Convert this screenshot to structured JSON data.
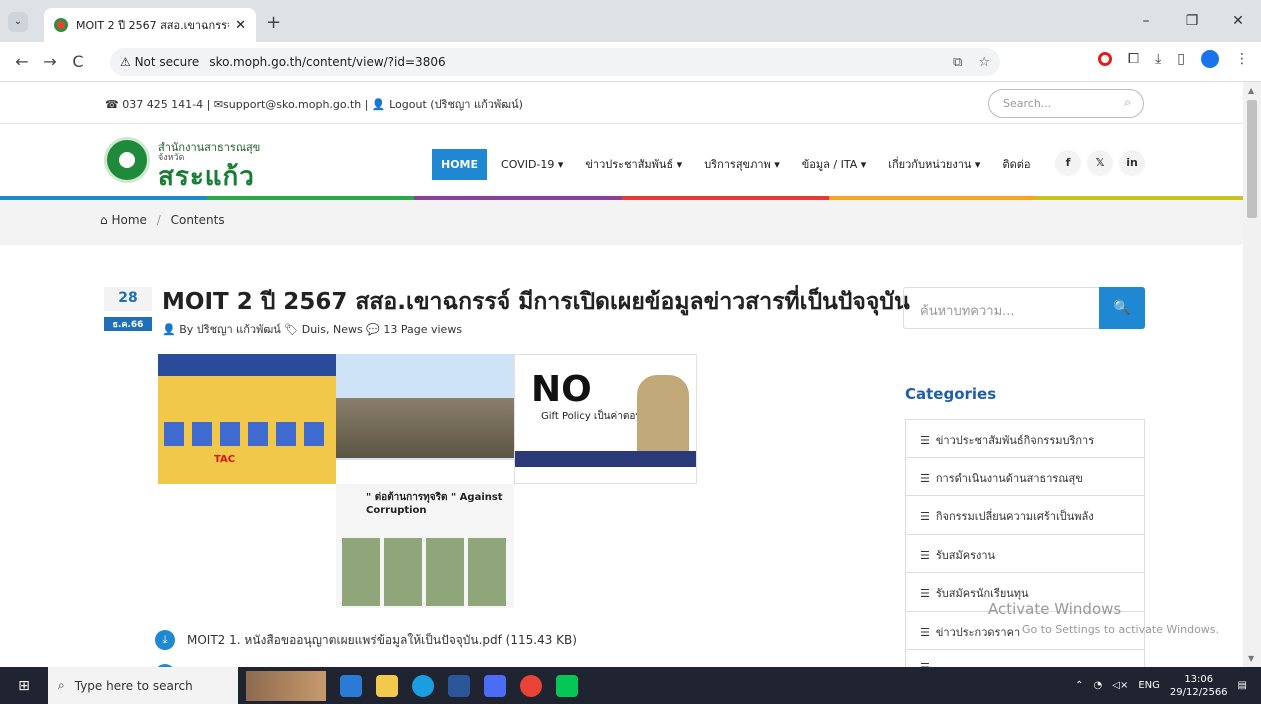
{
  "browser": {
    "tab_title": "MOIT 2 ปี 2567 สสอ.เขาฉกรรจ์ มีก",
    "tab_close": "✕",
    "new_tab": "+",
    "tab_list": "⌄",
    "back": "←",
    "forward": "→",
    "reload": "C",
    "security": "⚠ Not secure",
    "url": "sko.moph.go.th/content/view/?id=3806",
    "win_min": "–",
    "win_max": "❐",
    "win_close": "✕"
  },
  "topbar": {
    "contact": "☎ 037 425 141-4 | ✉support@sko.moph.go.th | 👤 Logout (ปริชญา แก้วพัฒน์)",
    "search_placeholder": "Search..."
  },
  "logo": {
    "line1": "สำนักงานสาธารณสุข",
    "line2": "จังหวัด",
    "line3": "สระแก้ว"
  },
  "menu": {
    "items": [
      "HOME",
      "COVID-19 ▾",
      "ข่าวประชาสัมพันธ์ ▾",
      "บริการสุขภาพ ▾",
      "ข้อมูล / ITA ▾",
      "เกี่ยวกับหน่วยงาน ▾",
      "ติดต่อ"
    ],
    "social": [
      "f",
      "𝕏",
      "in"
    ]
  },
  "colors": {
    "accent": "#1e88d2",
    "bar": [
      "#1e88d2",
      "#2ba84a",
      "#8a3f99",
      "#e53935",
      "#f5a623",
      "#c7c41c"
    ]
  },
  "breadcrumb": {
    "home": "Home",
    "current": "Contents",
    "separator": "/"
  },
  "article": {
    "day": "28",
    "month": "ธ.ค.66",
    "title": "MOIT 2 ปี 2567 สสอ.เขาฉกรรจ์ มีการเปิดเผยข้อมูลข่าวสารที่เป็นปัจจุบัน",
    "meta": "👤 By ปริชญา แก้วพัฒน์  🏷 Duis, News  💬 13 Page views",
    "img3_big": "NO",
    "img3_gift": "Gift Policy เป็นค่าตอบแทน",
    "img1_tac": "TAC",
    "img4_caption": "\" ต่อต้านการทุจริต \"\nAgainst Corruption",
    "attachment": "MOIT2 1. หนังสือขออนุญาตเผยแพร่ข้อมูลให้เป็นปัจจุบัน.pdf (115.43 KB)"
  },
  "sidebar": {
    "search_placeholder": "ค้นหาบทความ...",
    "search_button": "🔍",
    "categories_title": "Categories",
    "categories": [
      "ข่าวประชาสัมพันธ์กิจกรรมบริการ",
      "การดำเนินงานด้านสาธารณสุข",
      "กิจกรรมเปลี่ยนความเศร้าเป็นพลัง",
      "รับสมัครงาน",
      "รับสมัครนักเรียนทุน",
      "ข่าวประกวดราคา",
      ""
    ]
  },
  "watermark": {
    "line1": "Activate Windows",
    "line2": "Go to Settings to activate Windows."
  },
  "taskbar": {
    "search": "Type here to search",
    "lang": "ENG",
    "time": "13:06",
    "date": "29/12/2566"
  }
}
